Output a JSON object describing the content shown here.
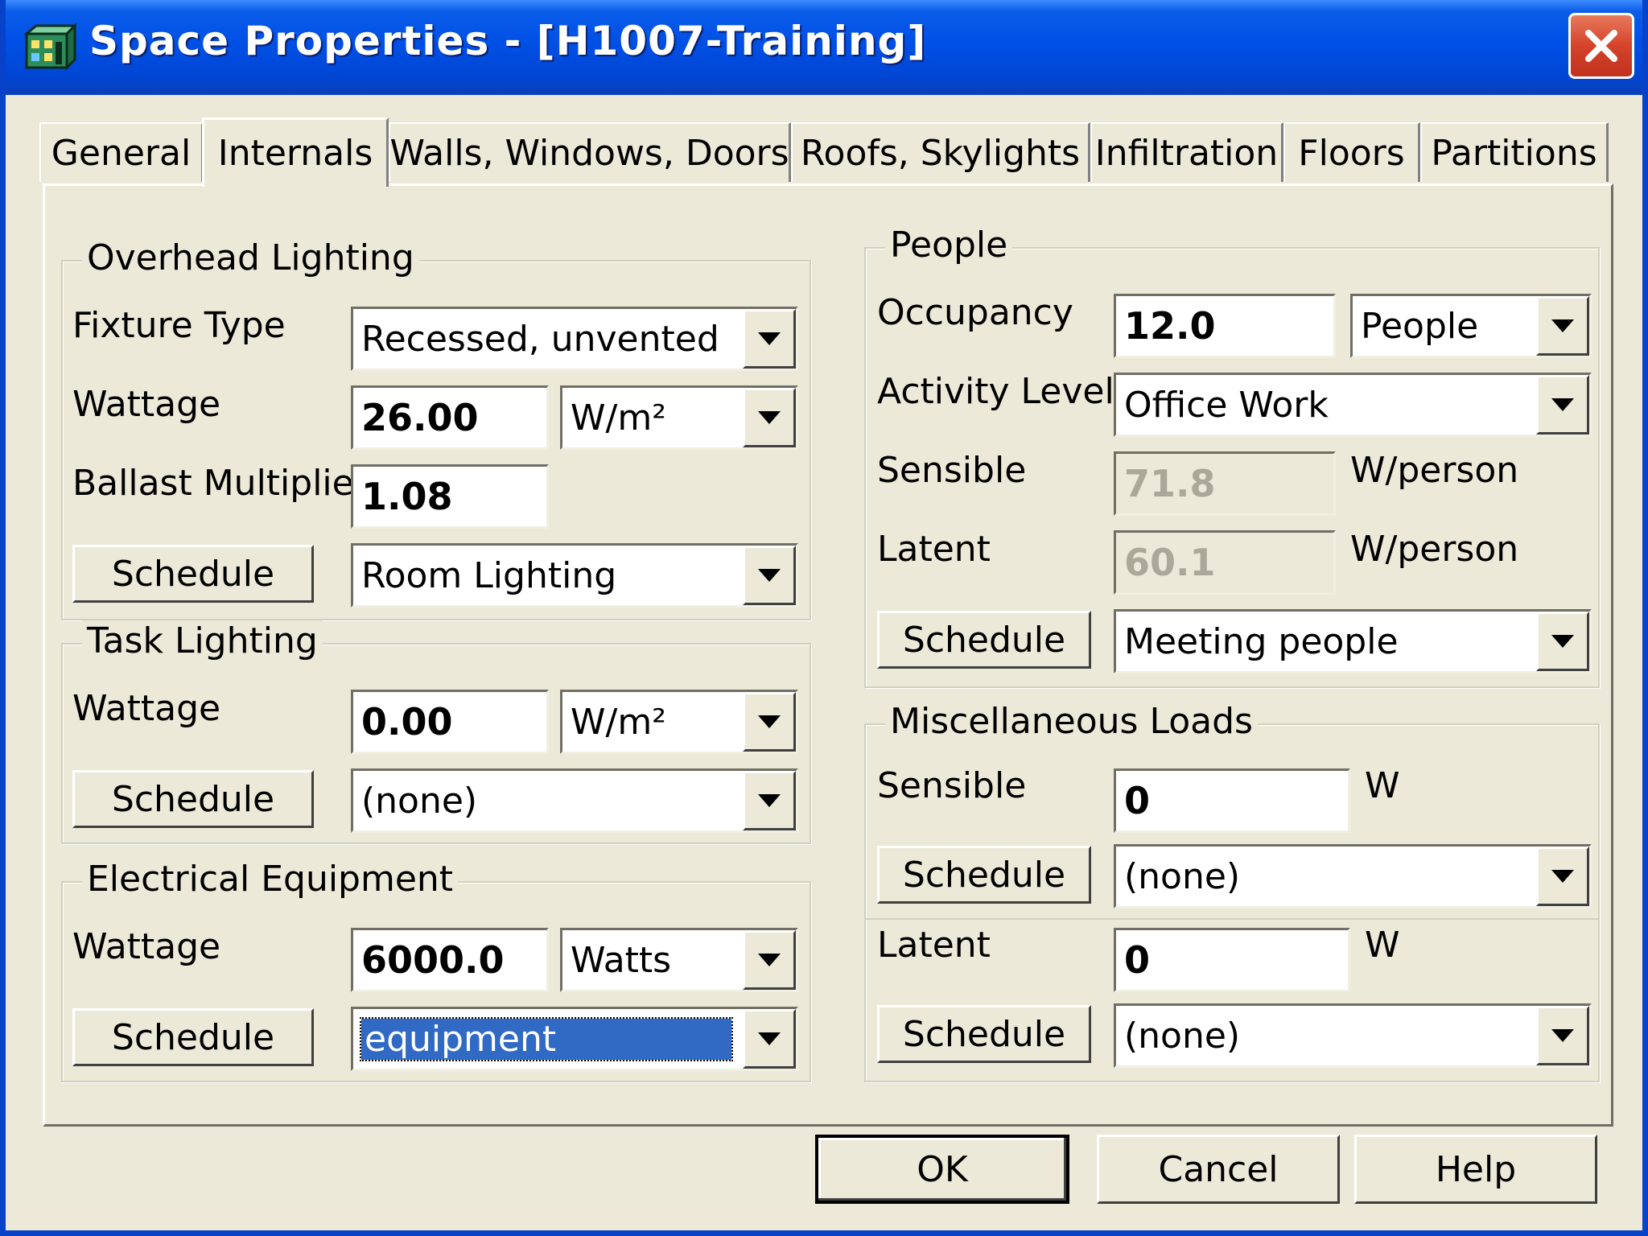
{
  "window": {
    "title": "Space Properties - [H1007-Training]"
  },
  "tabs": [
    {
      "label": "General"
    },
    {
      "label": "Internals"
    },
    {
      "label": "Walls, Windows, Doors"
    },
    {
      "label": "Roofs, Skylights"
    },
    {
      "label": "Infiltration"
    },
    {
      "label": "Floors"
    },
    {
      "label": "Partitions"
    }
  ],
  "overhead_lighting": {
    "group_label": "Overhead Lighting",
    "fixture_type_label": "Fixture Type",
    "fixture_type_value": "Recessed, unvented",
    "wattage_label": "Wattage",
    "wattage_value": "26.00",
    "wattage_unit": "W/m²",
    "ballast_label": "Ballast Multiplier",
    "ballast_value": "1.08",
    "schedule_button": "Schedule",
    "schedule_value": "Room Lighting"
  },
  "task_lighting": {
    "group_label": "Task Lighting",
    "wattage_label": "Wattage",
    "wattage_value": "0.00",
    "wattage_unit": "W/m²",
    "schedule_button": "Schedule",
    "schedule_value": "(none)"
  },
  "electrical_equipment": {
    "group_label": "Electrical Equipment",
    "wattage_label": "Wattage",
    "wattage_value": "6000.0",
    "wattage_unit": "Watts",
    "schedule_button": "Schedule",
    "schedule_value": "equipment"
  },
  "people": {
    "group_label": "People",
    "occupancy_label": "Occupancy",
    "occupancy_value": "12.0",
    "occupancy_unit": "People",
    "activity_label": "Activity Level",
    "activity_value": "Office Work",
    "sensible_label": "Sensible",
    "sensible_value": "71.8",
    "sensible_unit": "W/person",
    "latent_label": "Latent",
    "latent_value": "60.1",
    "latent_unit": "W/person",
    "schedule_button": "Schedule",
    "schedule_value": "Meeting people"
  },
  "misc_loads": {
    "group_label": "Miscellaneous Loads",
    "sensible_label": "Sensible",
    "sensible_value": "0",
    "sensible_unit": "W",
    "sensible_schedule_button": "Schedule",
    "sensible_schedule_value": "(none)",
    "latent_label": "Latent",
    "latent_value": "0",
    "latent_unit": "W",
    "latent_schedule_button": "Schedule",
    "latent_schedule_value": "(none)"
  },
  "footer": {
    "ok_label": "OK",
    "cancel_label": "Cancel",
    "help_label": "Help"
  },
  "colors": {
    "titlebar": "#0050e6",
    "dialog_bg": "#ece9d8",
    "close_red": "#d4432a",
    "selection": "#316ac5"
  }
}
